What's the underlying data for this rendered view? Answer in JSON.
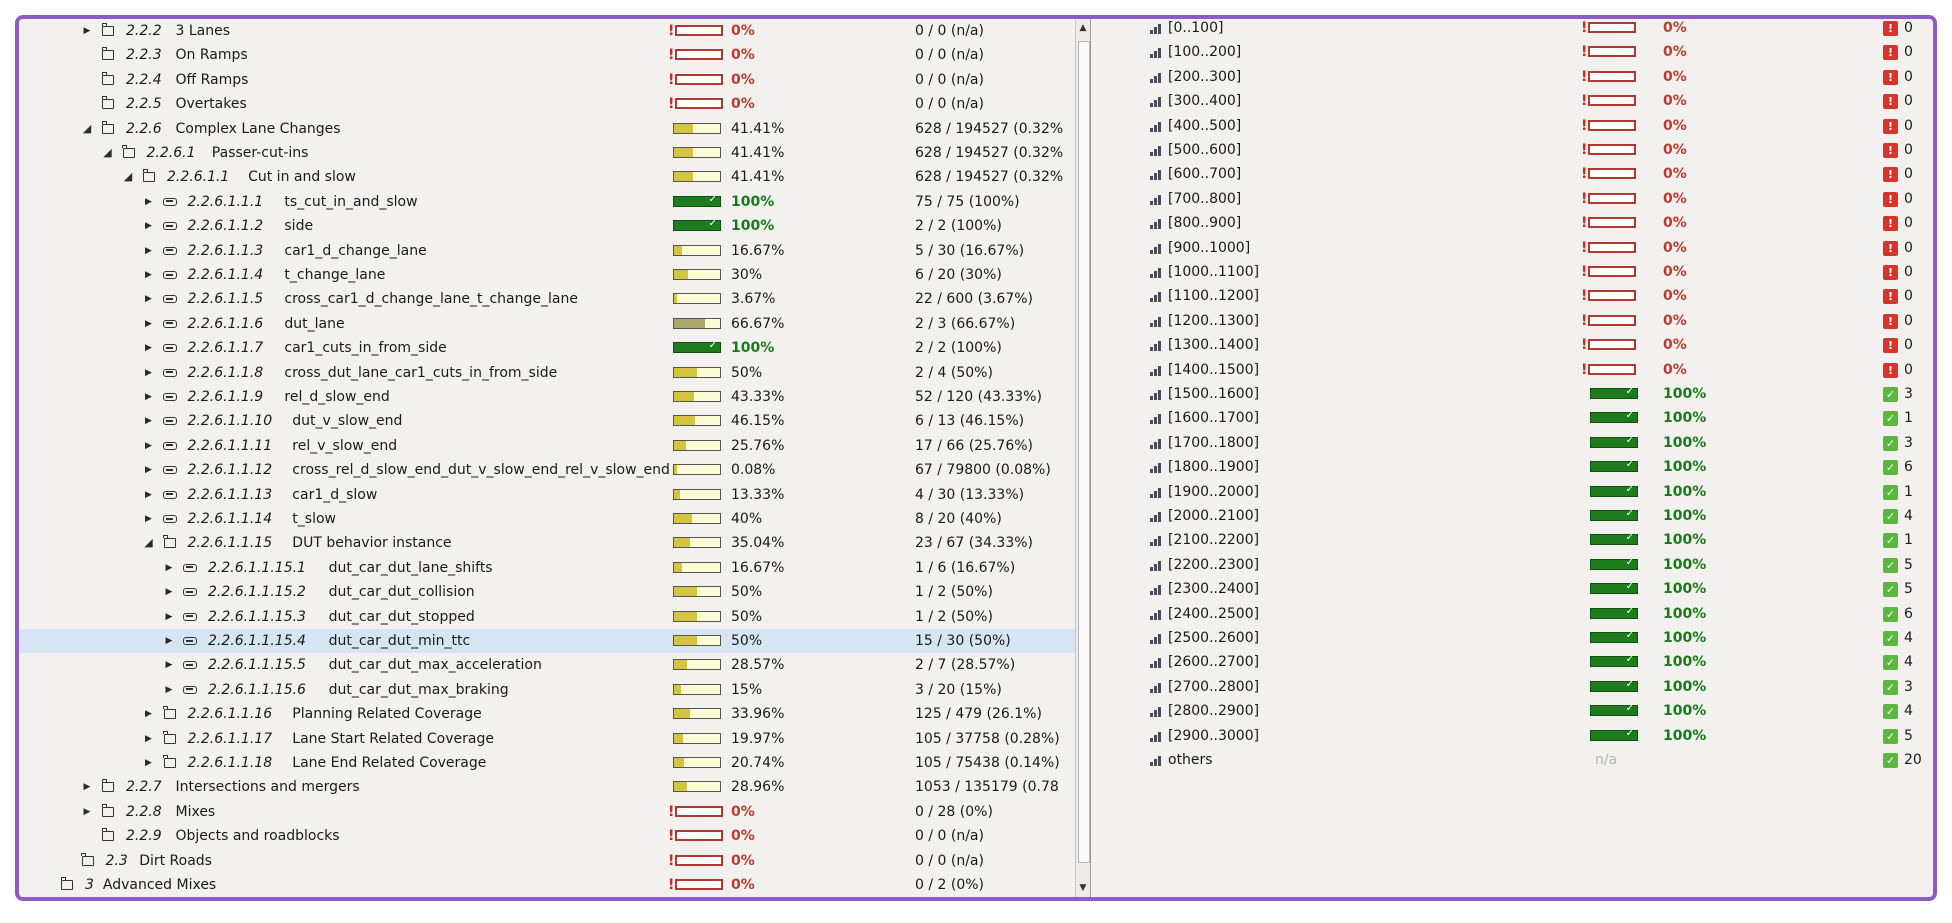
{
  "left_tree": {
    "rows": [
      {
        "depth": 2,
        "toggle": "collapsed",
        "icon": "folder",
        "num": "2.2.2",
        "name": "3 Lanes",
        "pct": "0%",
        "status": "zero",
        "fill": 0,
        "count": "0 / 0 (n/a)"
      },
      {
        "depth": 2,
        "toggle": "none",
        "icon": "folder",
        "num": "2.2.3",
        "name": "On Ramps",
        "pct": "0%",
        "status": "zero",
        "fill": 0,
        "count": "0 / 0 (n/a)"
      },
      {
        "depth": 2,
        "toggle": "none",
        "icon": "folder",
        "num": "2.2.4",
        "name": "Off Ramps",
        "pct": "0%",
        "status": "zero",
        "fill": 0,
        "count": "0 / 0 (n/a)"
      },
      {
        "depth": 2,
        "toggle": "none",
        "icon": "folder",
        "num": "2.2.5",
        "name": "Overtakes",
        "pct": "0%",
        "status": "zero",
        "fill": 0,
        "count": "0 / 0 (n/a)"
      },
      {
        "depth": 2,
        "toggle": "expanded",
        "icon": "folder",
        "num": "2.2.6",
        "name": "Complex Lane Changes",
        "pct": "41.41%",
        "status": "partial",
        "fill": 0.4141,
        "count": "628 / 194527 (0.32%"
      },
      {
        "depth": 3,
        "toggle": "expanded",
        "icon": "folder",
        "num": "2.2.6.1",
        "name": "Passer-cut-ins",
        "pct": "41.41%",
        "status": "partial",
        "fill": 0.4141,
        "count": "628 / 194527 (0.32%"
      },
      {
        "depth": 4,
        "toggle": "expanded",
        "icon": "folder",
        "num": "2.2.6.1.1",
        "name": "Cut in and slow",
        "pct": "41.41%",
        "status": "partial",
        "fill": 0.4141,
        "count": "628 / 194527 (0.32%"
      },
      {
        "depth": 5,
        "toggle": "collapsed",
        "icon": "cover",
        "num": "2.2.6.1.1.1",
        "name": "ts_cut_in_and_slow",
        "pct": "100%",
        "status": "full",
        "fill": 1,
        "count": "75 / 75 (100%)"
      },
      {
        "depth": 5,
        "toggle": "collapsed",
        "icon": "cover",
        "num": "2.2.6.1.1.2",
        "name": "side",
        "pct": "100%",
        "status": "full",
        "fill": 1,
        "count": "2 / 2 (100%)"
      },
      {
        "depth": 5,
        "toggle": "collapsed",
        "icon": "cover",
        "num": "2.2.6.1.1.3",
        "name": "car1_d_change_lane",
        "pct": "16.67%",
        "status": "partial",
        "fill": 0.1667,
        "count": "5 / 30 (16.67%)"
      },
      {
        "depth": 5,
        "toggle": "collapsed",
        "icon": "cover",
        "num": "2.2.6.1.1.4",
        "name": "t_change_lane",
        "pct": "30%",
        "status": "partial",
        "fill": 0.3,
        "count": "6 / 20 (30%)"
      },
      {
        "depth": 5,
        "toggle": "collapsed",
        "icon": "cover",
        "num": "2.2.6.1.1.5",
        "name": "cross_car1_d_change_lane_t_change_lane",
        "pct": "3.67%",
        "status": "partial",
        "fill": 0.0367,
        "count": "22 / 600 (3.67%)"
      },
      {
        "depth": 5,
        "toggle": "collapsed",
        "icon": "cover",
        "num": "2.2.6.1.1.6",
        "name": "dut_lane",
        "pct": "66.67%",
        "status": "mid",
        "fill": 0.6667,
        "count": "2 / 3 (66.67%)"
      },
      {
        "depth": 5,
        "toggle": "collapsed",
        "icon": "cover",
        "num": "2.2.6.1.1.7",
        "name": "car1_cuts_in_from_side",
        "pct": "100%",
        "status": "full",
        "fill": 1,
        "count": "2 / 2 (100%)"
      },
      {
        "depth": 5,
        "toggle": "collapsed",
        "icon": "cover",
        "num": "2.2.6.1.1.8",
        "name": "cross_dut_lane_car1_cuts_in_from_side",
        "pct": "50%",
        "status": "partial",
        "fill": 0.5,
        "count": "2 / 4 (50%)"
      },
      {
        "depth": 5,
        "toggle": "collapsed",
        "icon": "cover",
        "num": "2.2.6.1.1.9",
        "name": "rel_d_slow_end",
        "pct": "43.33%",
        "status": "partial",
        "fill": 0.4333,
        "count": "52 / 120 (43.33%)"
      },
      {
        "depth": 5,
        "toggle": "collapsed",
        "icon": "cover",
        "num": "2.2.6.1.1.10",
        "name": "dut_v_slow_end",
        "pct": "46.15%",
        "status": "partial",
        "fill": 0.4615,
        "count": "6 / 13 (46.15%)"
      },
      {
        "depth": 5,
        "toggle": "collapsed",
        "icon": "cover",
        "num": "2.2.6.1.1.11",
        "name": "rel_v_slow_end",
        "pct": "25.76%",
        "status": "partial",
        "fill": 0.2576,
        "count": "17 / 66 (25.76%)"
      },
      {
        "depth": 5,
        "toggle": "collapsed",
        "icon": "cover",
        "num": "2.2.6.1.1.12",
        "name": "cross_rel_d_slow_end_dut_v_slow_end_rel_v_slow_end",
        "pct": "0.08%",
        "status": "partial",
        "fill": 0.0008,
        "count": "67 / 79800 (0.08%)"
      },
      {
        "depth": 5,
        "toggle": "collapsed",
        "icon": "cover",
        "num": "2.2.6.1.1.13",
        "name": "car1_d_slow",
        "pct": "13.33%",
        "status": "partial",
        "fill": 0.1333,
        "count": "4 / 30 (13.33%)"
      },
      {
        "depth": 5,
        "toggle": "collapsed",
        "icon": "cover",
        "num": "2.2.6.1.1.14",
        "name": "t_slow",
        "pct": "40%",
        "status": "partial",
        "fill": 0.4,
        "count": "8 / 20 (40%)"
      },
      {
        "depth": 5,
        "toggle": "expanded",
        "icon": "folder",
        "num": "2.2.6.1.1.15",
        "name": "DUT behavior instance",
        "pct": "35.04%",
        "status": "partial",
        "fill": 0.3504,
        "count": "23 / 67 (34.33%)"
      },
      {
        "depth": 6,
        "toggle": "collapsed",
        "icon": "cover",
        "num": "2.2.6.1.1.15.1",
        "name": "dut_car_dut_lane_shifts",
        "pct": "16.67%",
        "status": "partial",
        "fill": 0.1667,
        "count": "1 / 6 (16.67%)"
      },
      {
        "depth": 6,
        "toggle": "collapsed",
        "icon": "cover",
        "num": "2.2.6.1.1.15.2",
        "name": "dut_car_dut_collision",
        "pct": "50%",
        "status": "partial",
        "fill": 0.5,
        "count": "1 / 2 (50%)"
      },
      {
        "depth": 6,
        "toggle": "collapsed",
        "icon": "cover",
        "num": "2.2.6.1.1.15.3",
        "name": "dut_car_dut_stopped",
        "pct": "50%",
        "status": "partial",
        "fill": 0.5,
        "count": "1 / 2 (50%)"
      },
      {
        "depth": 6,
        "toggle": "collapsed",
        "icon": "cover",
        "num": "2.2.6.1.1.15.4",
        "name": "dut_car_dut_min_ttc",
        "pct": "50%",
        "status": "partial",
        "fill": 0.5,
        "count": "15 / 30 (50%)",
        "selected": true
      },
      {
        "depth": 6,
        "toggle": "collapsed",
        "icon": "cover",
        "num": "2.2.6.1.1.15.5",
        "name": "dut_car_dut_max_acceleration",
        "pct": "28.57%",
        "status": "partial",
        "fill": 0.2857,
        "count": "2 / 7 (28.57%)"
      },
      {
        "depth": 6,
        "toggle": "collapsed",
        "icon": "cover",
        "num": "2.2.6.1.1.15.6",
        "name": "dut_car_dut_max_braking",
        "pct": "15%",
        "status": "partial",
        "fill": 0.15,
        "count": "3 / 20 (15%)"
      },
      {
        "depth": 5,
        "toggle": "collapsed",
        "icon": "folder",
        "num": "2.2.6.1.1.16",
        "name": "Planning Related Coverage",
        "pct": "33.96%",
        "status": "partial",
        "fill": 0.3396,
        "count": "125 / 479 (26.1%)"
      },
      {
        "depth": 5,
        "toggle": "collapsed",
        "icon": "folder",
        "num": "2.2.6.1.1.17",
        "name": "Lane Start Related Coverage",
        "pct": "19.97%",
        "status": "partial",
        "fill": 0.1997,
        "count": "105 / 37758 (0.28%)"
      },
      {
        "depth": 5,
        "toggle": "collapsed",
        "icon": "folder",
        "num": "2.2.6.1.1.18",
        "name": "Lane End Related Coverage",
        "pct": "20.74%",
        "status": "partial",
        "fill": 0.2074,
        "count": "105 / 75438 (0.14%)"
      },
      {
        "depth": 2,
        "toggle": "collapsed",
        "icon": "folder",
        "num": "2.2.7",
        "name": "Intersections and mergers",
        "pct": "28.96%",
        "status": "partial",
        "fill": 0.2896,
        "count": "1053 / 135179 (0.78"
      },
      {
        "depth": 2,
        "toggle": "collapsed",
        "icon": "folder",
        "num": "2.2.8",
        "name": "Mixes",
        "pct": "0%",
        "status": "zero",
        "fill": 0,
        "count": "0 / 28 (0%)"
      },
      {
        "depth": 2,
        "toggle": "none",
        "icon": "folder",
        "num": "2.2.9",
        "name": "Objects and roadblocks",
        "pct": "0%",
        "status": "zero",
        "fill": 0,
        "count": "0 / 0 (n/a)"
      },
      {
        "depth": 1,
        "toggle": "none",
        "icon": "folder",
        "num": "2.3",
        "name": "Dirt Roads",
        "pct": "0%",
        "status": "zero",
        "fill": 0,
        "count": "0 / 0 (n/a)"
      },
      {
        "depth": 0,
        "toggle": "none",
        "icon": "folder",
        "num": "3",
        "name": "Advanced Mixes",
        "pct": "0%",
        "status": "zero",
        "fill": 0,
        "count": "0 / 2 (0%)"
      }
    ]
  },
  "right_buckets": {
    "rows": [
      {
        "label": "[0..100]",
        "pct": "0%",
        "status": "zero",
        "hits": "0"
      },
      {
        "label": "[100..200]",
        "pct": "0%",
        "status": "zero",
        "hits": "0"
      },
      {
        "label": "[200..300]",
        "pct": "0%",
        "status": "zero",
        "hits": "0"
      },
      {
        "label": "[300..400]",
        "pct": "0%",
        "status": "zero",
        "hits": "0"
      },
      {
        "label": "[400..500]",
        "pct": "0%",
        "status": "zero",
        "hits": "0"
      },
      {
        "label": "[500..600]",
        "pct": "0%",
        "status": "zero",
        "hits": "0"
      },
      {
        "label": "[600..700]",
        "pct": "0%",
        "status": "zero",
        "hits": "0"
      },
      {
        "label": "[700..800]",
        "pct": "0%",
        "status": "zero",
        "hits": "0"
      },
      {
        "label": "[800..900]",
        "pct": "0%",
        "status": "zero",
        "hits": "0"
      },
      {
        "label": "[900..1000]",
        "pct": "0%",
        "status": "zero",
        "hits": "0"
      },
      {
        "label": "[1000..1100]",
        "pct": "0%",
        "status": "zero",
        "hits": "0"
      },
      {
        "label": "[1100..1200]",
        "pct": "0%",
        "status": "zero",
        "hits": "0"
      },
      {
        "label": "[1200..1300]",
        "pct": "0%",
        "status": "zero",
        "hits": "0"
      },
      {
        "label": "[1300..1400]",
        "pct": "0%",
        "status": "zero",
        "hits": "0"
      },
      {
        "label": "[1400..1500]",
        "pct": "0%",
        "status": "zero",
        "hits": "0"
      },
      {
        "label": "[1500..1600]",
        "pct": "100%",
        "status": "full",
        "hits": "3"
      },
      {
        "label": "[1600..1700]",
        "pct": "100%",
        "status": "full",
        "hits": "1"
      },
      {
        "label": "[1700..1800]",
        "pct": "100%",
        "status": "full",
        "hits": "3"
      },
      {
        "label": "[1800..1900]",
        "pct": "100%",
        "status": "full",
        "hits": "6"
      },
      {
        "label": "[1900..2000]",
        "pct": "100%",
        "status": "full",
        "hits": "1"
      },
      {
        "label": "[2000..2100]",
        "pct": "100%",
        "status": "full",
        "hits": "4"
      },
      {
        "label": "[2100..2200]",
        "pct": "100%",
        "status": "full",
        "hits": "1"
      },
      {
        "label": "[2200..2300]",
        "pct": "100%",
        "status": "full",
        "hits": "5"
      },
      {
        "label": "[2300..2400]",
        "pct": "100%",
        "status": "full",
        "hits": "5"
      },
      {
        "label": "[2400..2500]",
        "pct": "100%",
        "status": "full",
        "hits": "6"
      },
      {
        "label": "[2500..2600]",
        "pct": "100%",
        "status": "full",
        "hits": "4"
      },
      {
        "label": "[2600..2700]",
        "pct": "100%",
        "status": "full",
        "hits": "4"
      },
      {
        "label": "[2700..2800]",
        "pct": "100%",
        "status": "full",
        "hits": "3"
      },
      {
        "label": "[2800..2900]",
        "pct": "100%",
        "status": "full",
        "hits": "4"
      },
      {
        "label": "[2900..3000]",
        "pct": "100%",
        "status": "full",
        "hits": "5"
      },
      {
        "label": "others",
        "pct": "n/a",
        "status": "na",
        "hits": "20"
      }
    ]
  }
}
